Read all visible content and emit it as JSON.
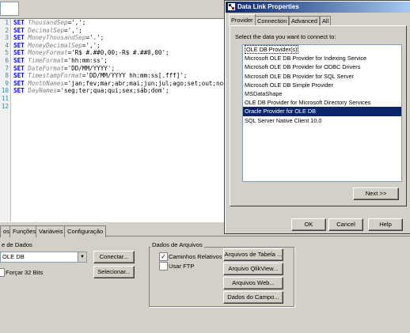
{
  "editor": {
    "lines": [
      {
        "n": "1",
        "kw": "SET",
        "var": "ThousandSep",
        "val": "=',';"
      },
      {
        "n": "2",
        "kw": "SET",
        "var": "DecimalSep",
        "val": "=',';"
      },
      {
        "n": "3",
        "kw": "SET",
        "var": "MoneyThousandSep",
        "val": "='.';"
      },
      {
        "n": "4",
        "kw": "SET",
        "var": "MoneyDecimalSep",
        "val": "=',';"
      },
      {
        "n": "5",
        "kw": "SET",
        "var": "MoneyFormat",
        "val": "='R$ #.##0,00;-R$ #.##0,00';"
      },
      {
        "n": "6",
        "kw": "SET",
        "var": "TimeFormat",
        "val": "='hh:mm:ss';"
      },
      {
        "n": "7",
        "kw": "SET",
        "var": "DateFormat",
        "val": "='DD/MM/YYYY';"
      },
      {
        "n": "8",
        "kw": "SET",
        "var": "TimestampFormat",
        "val": "='DD/MM/YYYY hh:mm:ss[.fff]';"
      },
      {
        "n": "9",
        "kw": "SET",
        "var": "MonthNames",
        "val": "='jan;fev;mar;abr;mai;jun;jul;ago;set;out;no"
      },
      {
        "n": "10",
        "kw": "SET",
        "var": "DayNames",
        "val": "='seg;ter;qua;qui;sex;sáb;dom';"
      },
      {
        "n": "11",
        "kw": "",
        "var": "",
        "val": ""
      },
      {
        "n": "12",
        "kw": "",
        "var": "",
        "val": ""
      }
    ]
  },
  "bottom": {
    "tabs": [
      "os",
      "Funções",
      "Variáveis",
      "Configuração"
    ],
    "source_label": "e de Dados",
    "source_value": "OLE DB",
    "connect_button": "Conectar...",
    "select_button": "Selecionar...",
    "force32_label": "Forçar 32 Bits",
    "files_group_title": "Dados de Arquivos",
    "relative_paths_label": "Caminhos Relativos",
    "use_ftp_label": "Usar FTP",
    "table_files_button": "Arquivos de Tabela ...",
    "qlikview_files_button": "Arquivo QlikView...",
    "web_files_button": "Arquivos Web...",
    "field_data_button": "Dados do Campo..."
  },
  "dialog": {
    "title": "Data Link Properties",
    "tabs": [
      "Provider",
      "Connection",
      "Advanced",
      "All"
    ],
    "instruction": "Select the data you want to connect to:",
    "providers": [
      "OLE DB Provider(s)",
      "Microsoft OLE DB Provider for Indexing Service",
      "Microsoft OLE DB Provider for ODBC Drivers",
      "Microsoft OLE DB Provider for SQL Server",
      "Microsoft OLE DB Simple Provider",
      "MSDataShape",
      "OLE DB Provider for Microsoft Directory Services",
      "Oracle Provider for OLE DB",
      "SQL Server Native Client 10.0"
    ],
    "selected_provider": "Oracle Provider for OLE DB",
    "next_button": "Next >>",
    "ok_button": "OK",
    "cancel_button": "Cancel",
    "help_button": "Help"
  },
  "colors": {
    "keyword": "#0000ff",
    "selection": "#0a246a",
    "title_gradient_start": "#0a246a"
  }
}
